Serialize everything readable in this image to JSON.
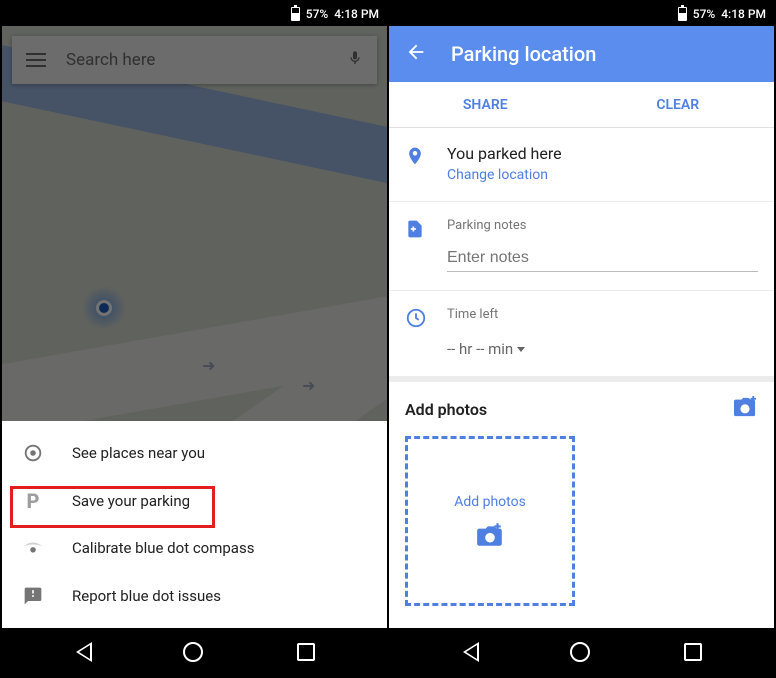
{
  "status": {
    "battery": "57%",
    "time": "4:18 PM"
  },
  "left": {
    "search_placeholder": "Search here",
    "sheet": {
      "see_places": "See places near you",
      "save_parking": "Save your parking",
      "calibrate": "Calibrate blue dot compass",
      "report": "Report blue dot issues"
    }
  },
  "right": {
    "title": "Parking location",
    "actions": {
      "share": "SHARE",
      "clear": "CLEAR"
    },
    "parked": {
      "title": "You parked here",
      "change": "Change location"
    },
    "notes": {
      "label": "Parking notes",
      "placeholder": "Enter notes"
    },
    "time": {
      "label": "Time left",
      "value": "-- hr -- min"
    },
    "photos": {
      "heading": "Add photos",
      "drop_label": "Add photos"
    }
  }
}
